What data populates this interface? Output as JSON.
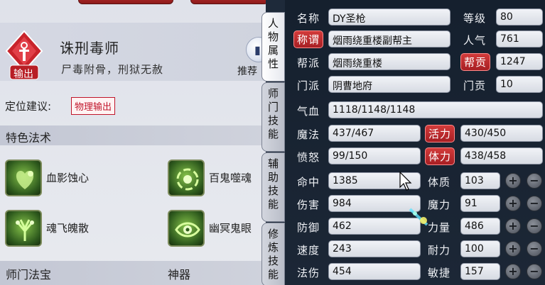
{
  "school": {
    "name": "诛刑毒师",
    "description": "尸毒附骨，刑狱无赦",
    "role_badge": "输出",
    "recommend_label": "推荐",
    "recommend_icon": "recommend-book-icon"
  },
  "position": {
    "label": "定位建议:",
    "value": "物理输出"
  },
  "special_skills": {
    "title": "特色法术",
    "items": [
      {
        "name": "血影蚀心",
        "icon": "heart-shadow-icon"
      },
      {
        "name": "百鬼噬魂",
        "icon": "ghost-swirl-icon"
      },
      {
        "name": "魂飞魄散",
        "icon": "spirit-tree-icon"
      },
      {
        "name": "幽冥鬼眼",
        "icon": "ghost-eye-icon"
      }
    ]
  },
  "bottom_sections": {
    "treasure": "师门法宝",
    "artifact": "神器"
  },
  "tabs": [
    {
      "label": "人物属性",
      "active": true
    },
    {
      "label": "师门技能",
      "active": false
    },
    {
      "label": "辅助技能",
      "active": false
    },
    {
      "label": "修炼技能",
      "active": false
    }
  ],
  "character": {
    "name_label": "名称",
    "name": "DY圣枪",
    "level_label": "等级",
    "level": "80",
    "title_label": "称谓",
    "title": "烟雨绕重楼副帮主",
    "popularity_label": "人气",
    "popularity": "761",
    "guild_label": "帮派",
    "guild": "烟雨绕重楼",
    "contribution_label": "帮贡",
    "contribution": "1247",
    "sect_label": "门派",
    "sect": "阴曹地府",
    "sect_contribution_label": "门贡",
    "sect_contribution": "10",
    "hp_label": "气血",
    "hp": "1118/1148/1148",
    "mp_label": "魔法",
    "mp": "437/467",
    "vitality_label": "活力",
    "vitality": "430/450",
    "anger_label": "愤怒",
    "anger": "99/150",
    "stamina_label": "体力",
    "stamina": "438/458"
  },
  "combat": [
    {
      "label": "命中",
      "value": "1385"
    },
    {
      "label": "伤害",
      "value": "984"
    },
    {
      "label": "防御",
      "value": "462"
    },
    {
      "label": "速度",
      "value": "243"
    },
    {
      "label": "法伤",
      "value": "454"
    }
  ],
  "attributes": [
    {
      "label": "体质",
      "value": "103"
    },
    {
      "label": "魔力",
      "value": "91"
    },
    {
      "label": "力量",
      "value": "486"
    },
    {
      "label": "耐力",
      "value": "100"
    },
    {
      "label": "敏捷",
      "value": "157"
    }
  ],
  "buttons": {
    "plus": "+",
    "minus": "−"
  },
  "colors": {
    "accent_red": "#c0152a",
    "panel_dark": "#15202e",
    "value_box": "#e6e9ef"
  }
}
